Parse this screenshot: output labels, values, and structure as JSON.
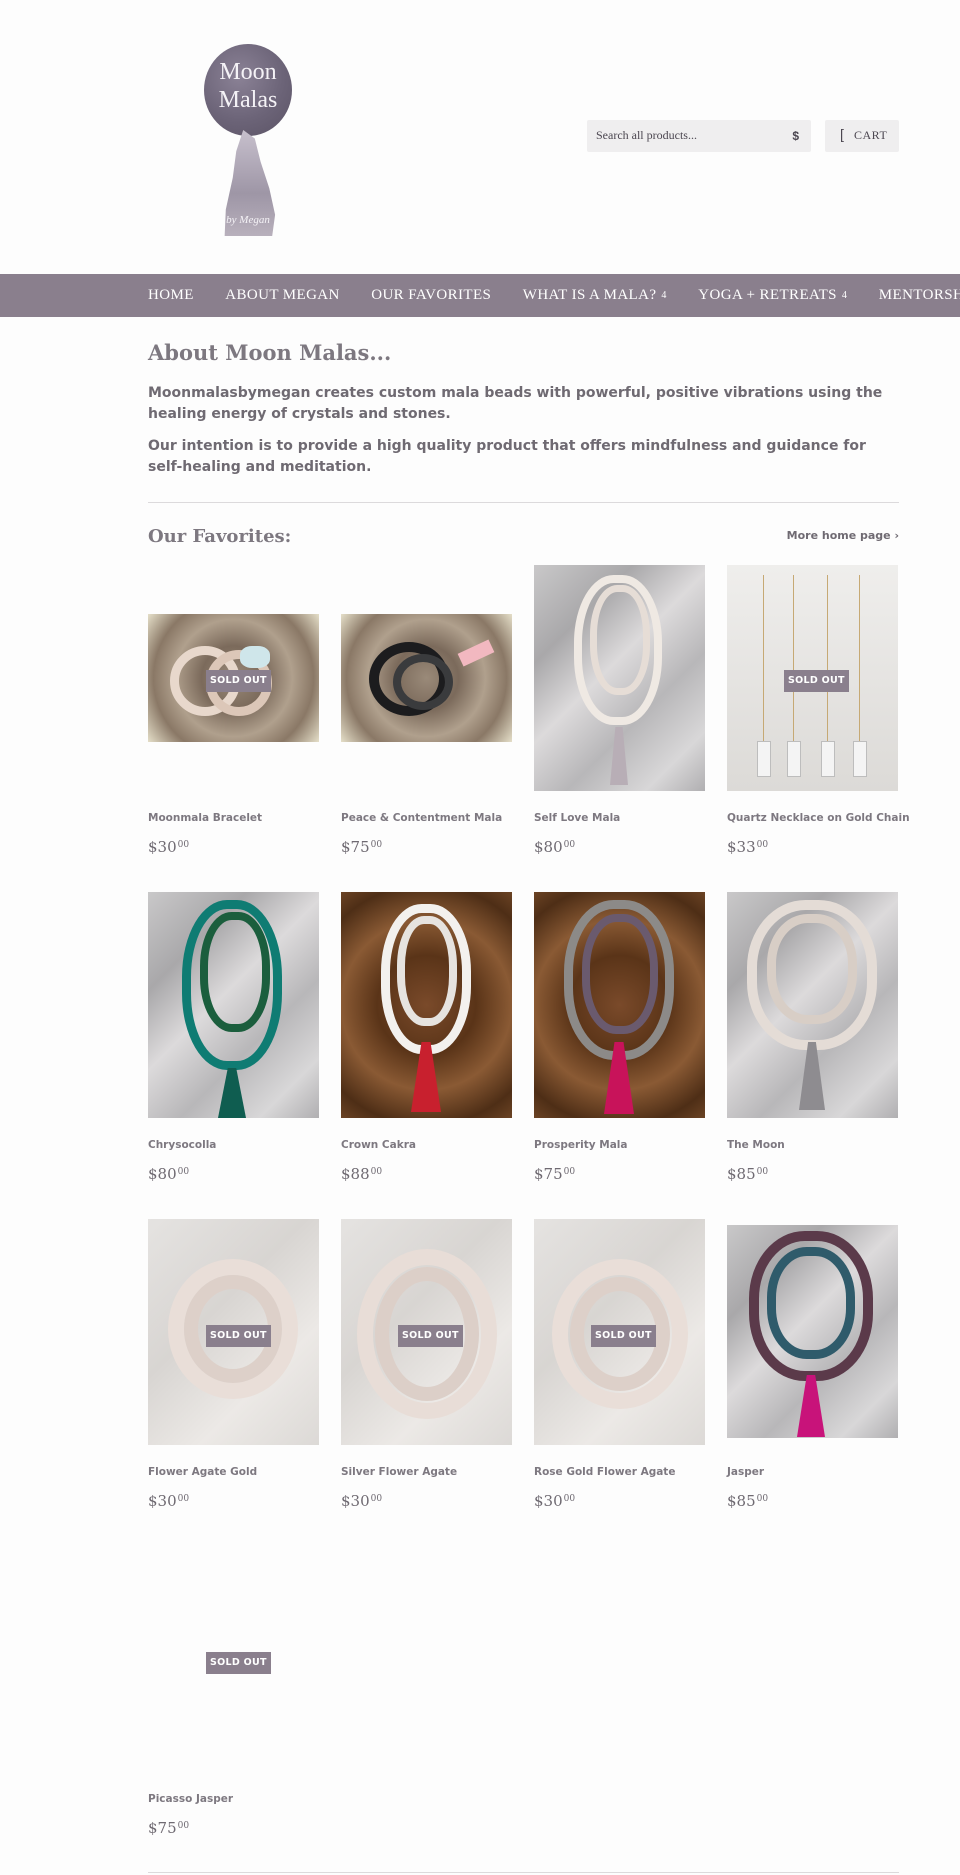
{
  "brand": {
    "logo_text_line1": "Moon",
    "logo_text_line2": "Malas",
    "logo_byline": "by Megan",
    "accent_color": "#8a7f8d"
  },
  "header": {
    "search_placeholder": "Search all products...",
    "search_icon": "search-icon",
    "cart_label": "CART",
    "cart_icon": "cart-icon"
  },
  "nav": {
    "items": [
      {
        "label": "HOME",
        "has_dropdown": false
      },
      {
        "label": "ABOUT MEGAN",
        "has_dropdown": false
      },
      {
        "label": "OUR FAVORITES",
        "has_dropdown": false
      },
      {
        "label": "WHAT IS A MALA?",
        "has_dropdown": true
      },
      {
        "label": "YOGA + RETREATS",
        "has_dropdown": true
      },
      {
        "label": "MENTORSHIP",
        "has_dropdown": false
      }
    ],
    "dropdown_glyph": "4"
  },
  "about": {
    "title": "About Moon Malas...",
    "paragraph1": "Moonmalasbymegan creates custom mala beads with powerful, positive vibrations using the healing energy of crystals and stones.",
    "paragraph2": "Our intention is to provide a high quality product that offers mindfulness and guidance for self-healing and meditation."
  },
  "favorites": {
    "title": "Our Favorites:",
    "more_link": "More home page ›",
    "sold_out_label": "SOLD OUT",
    "products": [
      {
        "name": "Moonmala Bracelet",
        "price_main": "$30",
        "price_cents": "00",
        "sold_out": true
      },
      {
        "name": "Peace & Contentment Mala",
        "price_main": "$75",
        "price_cents": "00",
        "sold_out": false
      },
      {
        "name": "Self Love Mala",
        "price_main": "$80",
        "price_cents": "00",
        "sold_out": false
      },
      {
        "name": "Quartz Necklace on Gold Chain",
        "price_main": "$33",
        "price_cents": "00",
        "sold_out": true
      },
      {
        "name": "Chrysocolla",
        "price_main": "$80",
        "price_cents": "00",
        "sold_out": false
      },
      {
        "name": "Crown Cakra",
        "price_main": "$88",
        "price_cents": "00",
        "sold_out": false
      },
      {
        "name": "Prosperity Mala",
        "price_main": "$75",
        "price_cents": "00",
        "sold_out": false
      },
      {
        "name": "The Moon",
        "price_main": "$85",
        "price_cents": "00",
        "sold_out": false
      },
      {
        "name": "Flower Agate Gold",
        "price_main": "$30",
        "price_cents": "00",
        "sold_out": true
      },
      {
        "name": "Silver Flower Agate",
        "price_main": "$30",
        "price_cents": "00",
        "sold_out": true
      },
      {
        "name": "Rose Gold Flower Agate",
        "price_main": "$30",
        "price_cents": "00",
        "sold_out": true
      },
      {
        "name": "Jasper",
        "price_main": "$85",
        "price_cents": "00",
        "sold_out": false
      },
      {
        "name": "Picasso Jasper",
        "price_main": "$75",
        "price_cents": "00",
        "sold_out": true
      }
    ]
  }
}
